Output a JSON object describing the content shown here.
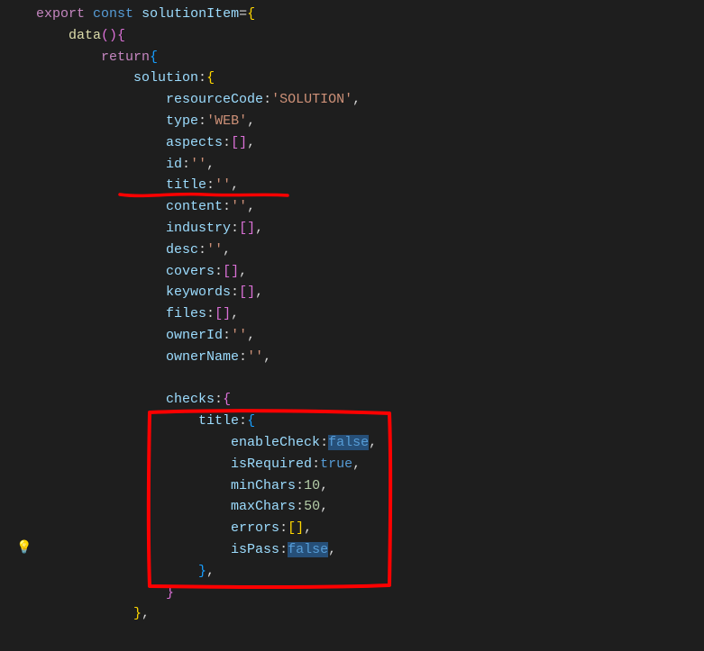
{
  "code": {
    "l1_export": "export",
    "l1_const": "const",
    "l1_name": "solutionItem",
    "l1_eq": "=",
    "l1_open": "{",
    "l2_fn": "data",
    "l2_paren": "()",
    "l2_open": "{",
    "l3_return": "return",
    "l3_open": "{",
    "l4_prop": "solution",
    "l4_colon": ":",
    "l4_open": "{",
    "l5_prop": "resourceCode",
    "l5_colon": ":",
    "l5_val": "'SOLUTION'",
    "l5_comma": ",",
    "l6_prop": "type",
    "l6_colon": ":",
    "l6_val": "'WEB'",
    "l6_comma": ",",
    "l7_prop": "aspects",
    "l7_colon": ":",
    "l7_open": "[",
    "l7_close": "]",
    "l7_comma": ",",
    "l8_prop": "id",
    "l8_colon": ":",
    "l8_val": "''",
    "l8_comma": ",",
    "l9_prop": "title",
    "l9_colon": ":",
    "l9_val": "''",
    "l9_comma": ",",
    "l10_prop": "content",
    "l10_colon": ":",
    "l10_val": "''",
    "l10_comma": ",",
    "l11_prop": "industry",
    "l11_colon": ":",
    "l11_open": "[",
    "l11_close": "]",
    "l11_comma": ",",
    "l12_prop": "desc",
    "l12_colon": ":",
    "l12_val": "''",
    "l12_comma": ",",
    "l13_prop": "covers",
    "l13_colon": ":",
    "l13_open": "[",
    "l13_close": "]",
    "l13_comma": ",",
    "l14_prop": "keywords",
    "l14_colon": ":",
    "l14_open": "[",
    "l14_close": "]",
    "l14_comma": ",",
    "l15_prop": "files",
    "l15_colon": ":",
    "l15_open": "[",
    "l15_close": "]",
    "l15_comma": ",",
    "l16_prop": "ownerId",
    "l16_colon": ":",
    "l16_val": "''",
    "l16_comma": ",",
    "l17_prop": "ownerName",
    "l17_colon": ":",
    "l17_val": "''",
    "l17_comma": ",",
    "l19_prop": "checks",
    "l19_colon": ":",
    "l19_open": "{",
    "l20_prop": "title",
    "l20_colon": ":",
    "l20_open": "{",
    "l21_prop": "enableCheck",
    "l21_colon": ":",
    "l21_val": "false",
    "l21_comma": ",",
    "l22_prop": "isRequired",
    "l22_colon": ":",
    "l22_val": "true",
    "l22_comma": ",",
    "l23_prop": "minChars",
    "l23_colon": ":",
    "l23_val": "10",
    "l23_comma": ",",
    "l24_prop": "maxChars",
    "l24_colon": ":",
    "l24_val": "50",
    "l24_comma": ",",
    "l25_prop": "errors",
    "l25_colon": ":",
    "l25_open": "[",
    "l25_close": "]",
    "l25_comma": ",",
    "l26_prop": "isPass",
    "l26_colon": ":",
    "l26_val": "false",
    "l26_comma": ",",
    "l27_close": "}",
    "l27_comma": ",",
    "l28_close": "}",
    "l29_close": "}",
    "l29_comma": ","
  },
  "lightbulb_glyph": "💡"
}
